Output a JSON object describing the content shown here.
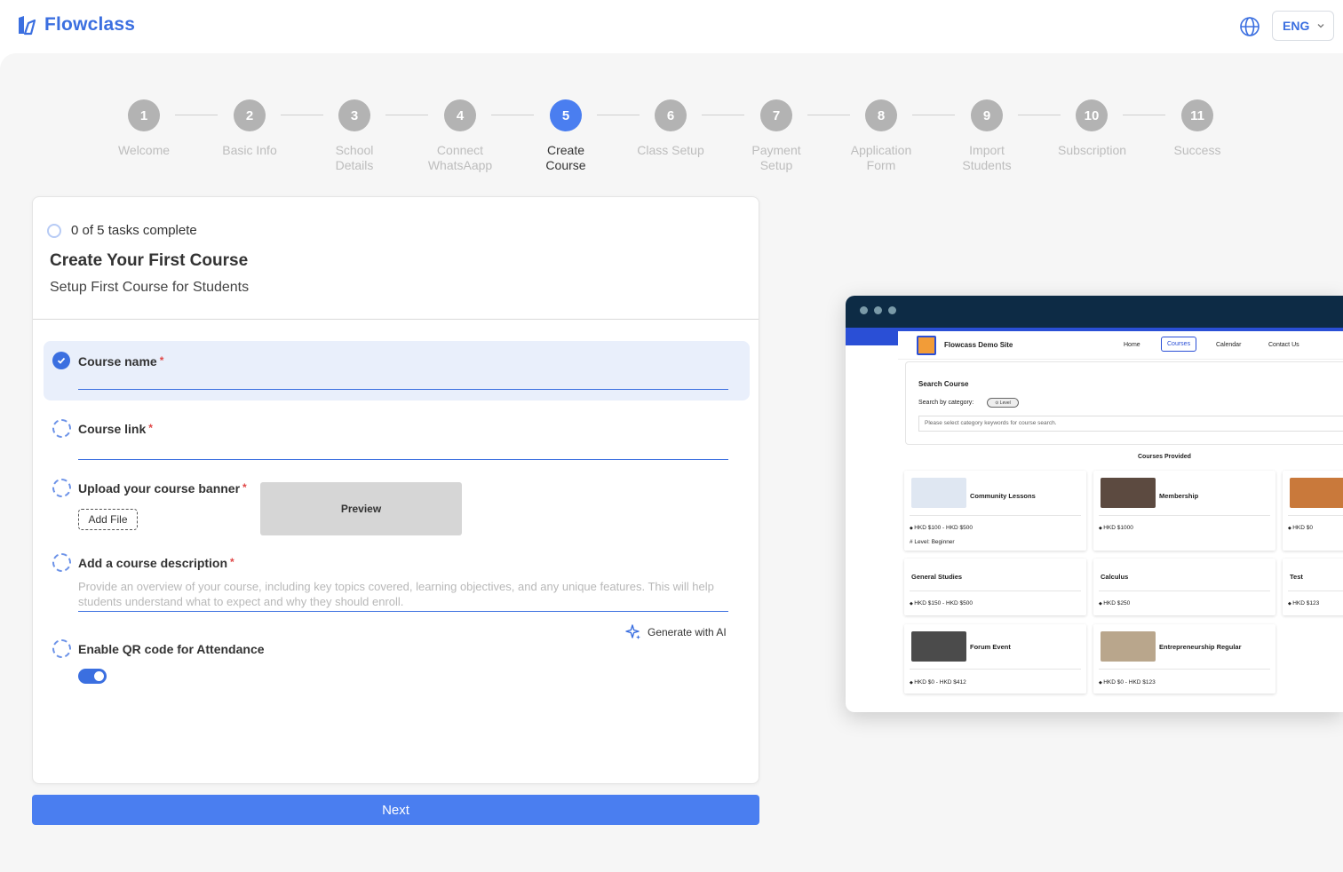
{
  "header": {
    "brand": "Flowclass",
    "language": "ENG"
  },
  "stepper": {
    "steps": [
      {
        "number": "1",
        "label": "Welcome"
      },
      {
        "number": "2",
        "label": "Basic Info"
      },
      {
        "number": "3",
        "label": "School Details"
      },
      {
        "number": "4",
        "label": "Connect WhatsAapp"
      },
      {
        "number": "5",
        "label": "Create Course"
      },
      {
        "number": "6",
        "label": "Class Setup"
      },
      {
        "number": "7",
        "label": "Payment Setup"
      },
      {
        "number": "8",
        "label": "Application Form"
      },
      {
        "number": "9",
        "label": "Import Students"
      },
      {
        "number": "10",
        "label": "Subscription"
      },
      {
        "number": "11",
        "label": "Success"
      }
    ],
    "active_step": 5
  },
  "card": {
    "progress": "0 of 5 tasks complete",
    "title": "Create Your First Course",
    "subtitle": "Setup First Course for Students",
    "fields": {
      "course_name": "Course name",
      "course_link": "Course link",
      "banner": "Upload your course banner",
      "add_file": "Add File",
      "preview": "Preview",
      "description": "Add a course description",
      "description_placeholder": "Provide an overview of your course, including key topics covered, learning objectives, and any unique features. This will help students understand what to expect and why they should enroll.",
      "generate_ai": "Generate with AI",
      "qr": "Enable QR code for Attendance",
      "required_mark": "*"
    },
    "qr_enabled": true
  },
  "next_button": "Next",
  "mock_site": {
    "site_name": "Flowcass Demo Site",
    "nav": [
      "Home",
      "Courses",
      "Calendar",
      "Contact Us"
    ],
    "search_title": "Search Course",
    "search_by": "Search by category:",
    "chip": "⊙ Level",
    "search_placeholder": "Please select category keywords for course search.",
    "courses_provided": "Courses Provided",
    "courses": [
      {
        "name": "Community Lessons",
        "price": "HKD $100 - HKD $500",
        "level": "Level: Beginner"
      },
      {
        "name": "Membership",
        "price": "HKD $1000"
      },
      {
        "name": "",
        "price": "HKD $0"
      },
      {
        "name": "General Studies",
        "price": "HKD $150 - HKD $500"
      },
      {
        "name": "Calculus",
        "price": "HKD $250"
      },
      {
        "name": "Test",
        "price": "HKD $123"
      },
      {
        "name": "Forum Event",
        "price": "HKD $0 - HKD $412"
      },
      {
        "name": "Entrepreneurship Regular",
        "price": "HKD $0 - HKD $123"
      }
    ]
  },
  "colors": {
    "brand": "#3b6fe0",
    "active_step": "#4a7ef0",
    "inactive_step": "#b3b3b3",
    "mock_topbar": "#0d2b45"
  }
}
